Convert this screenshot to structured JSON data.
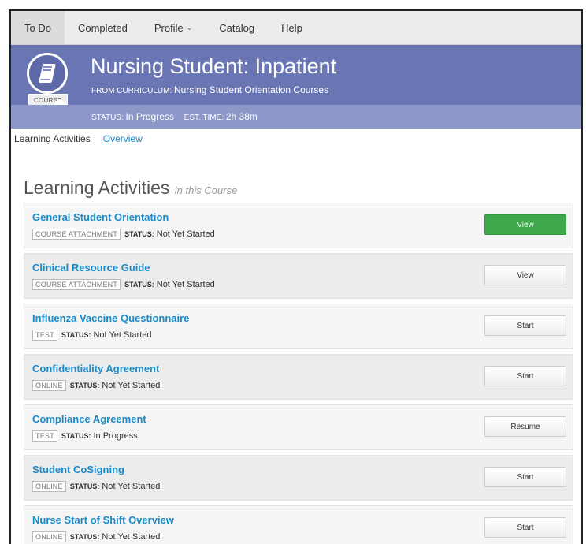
{
  "nav": {
    "items": [
      {
        "label": "To Do",
        "active": true
      },
      {
        "label": "Completed"
      },
      {
        "label": "Profile",
        "caret": "⌄"
      },
      {
        "label": "Catalog"
      },
      {
        "label": "Help"
      }
    ]
  },
  "course": {
    "badge_label": "COURSE",
    "icon": "book-icon",
    "title": "Nursing Student: Inpatient",
    "from_label": "FROM CURRICULUM:",
    "curriculum": "Nursing Student Orientation Courses",
    "status_label": "STATUS:",
    "status_value": "In Progress",
    "time_label": "EST. TIME:",
    "time_value": "2h 38m"
  },
  "subtabs": [
    {
      "label": "Learning Activities",
      "active": true
    },
    {
      "label": "Overview"
    }
  ],
  "section": {
    "title": "Learning Activities",
    "subtitle": "in this Course"
  },
  "activities": [
    {
      "name": "General Student Orientation",
      "type": "COURSE ATTACHMENT",
      "status_label": "STATUS:",
      "status": "Not Yet Started",
      "action": "View",
      "primary": true
    },
    {
      "name": "Clinical Resource Guide",
      "type": "COURSE ATTACHMENT",
      "status_label": "STATUS:",
      "status": "Not Yet Started",
      "action": "View"
    },
    {
      "name": "Influenza Vaccine Questionnaire",
      "type": "TEST",
      "status_label": "STATUS:",
      "status": "Not Yet Started",
      "action": "Start"
    },
    {
      "name": "Confidentiality Agreement",
      "type": "ONLINE",
      "status_label": "STATUS:",
      "status": "Not Yet Started",
      "action": "Start"
    },
    {
      "name": "Compliance Agreement",
      "type": "TEST",
      "status_label": "STATUS:",
      "status": "In Progress",
      "action": "Resume"
    },
    {
      "name": "Student CoSigning",
      "type": "ONLINE",
      "status_label": "STATUS:",
      "status": "Not Yet Started",
      "action": "Start"
    },
    {
      "name": "Nurse Start of Shift Overview",
      "type": "ONLINE",
      "status_label": "STATUS:",
      "status": "Not Yet Started",
      "action": "Start"
    }
  ],
  "colors": {
    "banner": "#6a76b3",
    "subbar": "#8d97c8",
    "link": "#1a8bc8",
    "primary_button": "#3ea84a"
  }
}
